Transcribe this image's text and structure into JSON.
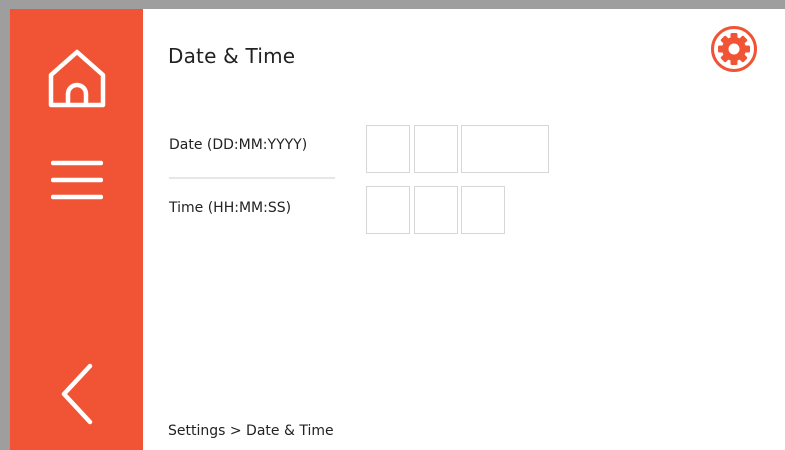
{
  "header": {
    "title": "Date & Time",
    "settings_icon": "gear-icon"
  },
  "sidebar": {
    "home_icon": "home-icon",
    "menu_icon": "menu-icon",
    "back_icon": "chevron-left-icon"
  },
  "form": {
    "date_label": "Date (DD:MM:YYYY)",
    "time_label": "Time (HH:MM:SS)",
    "date_day": "",
    "date_month": "",
    "date_year": "",
    "time_hours": "",
    "time_minutes": "",
    "time_seconds": ""
  },
  "breadcrumb": "Settings > Date & Time",
  "colors": {
    "accent": "#f05435",
    "background": "#ffffff",
    "bezel": "#9e9e9e"
  }
}
